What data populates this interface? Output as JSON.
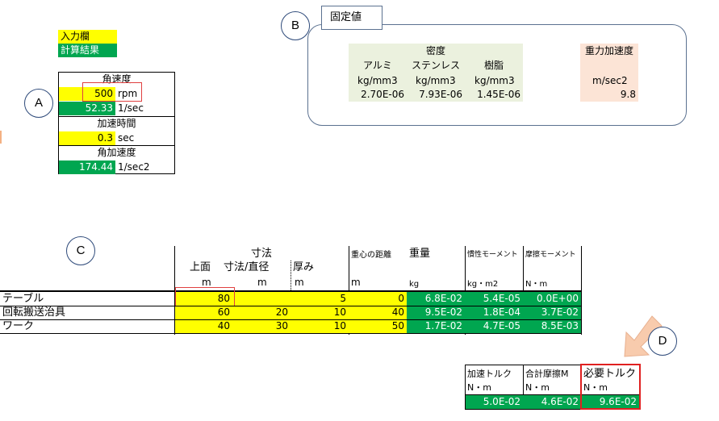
{
  "legend": {
    "input": "入力欄",
    "calc": "計算結果"
  },
  "markers": {
    "a": "A",
    "b": "B",
    "c": "C",
    "d": "D"
  },
  "sectionA": {
    "angvel_label": "角速度",
    "rpm_value": "500",
    "rpm_unit": "rpm",
    "angvel_value": "52.33",
    "angvel_unit": "1/sec",
    "acctime_label": "加速時間",
    "acctime_value": "0.3",
    "acctime_unit": "sec",
    "angacc_label": "角加速度",
    "angacc_value": "174.44",
    "angacc_unit": "1/sec2"
  },
  "sectionB": {
    "title": "固定値",
    "density_label": "密度",
    "materials": [
      "アルミ",
      "ステンレス",
      "樹脂"
    ],
    "units": [
      "kg/mm3",
      "kg/mm3",
      "kg/mm3"
    ],
    "values": [
      "2.70E-06",
      "7.93E-06",
      "1.45E-06"
    ],
    "gravity_label": "重力加速度",
    "gravity_unit": "m/sec2",
    "gravity_value": "9.8"
  },
  "sectionC": {
    "header": {
      "dims": "寸法",
      "top": "上面",
      "dim_dia": "寸法/直径",
      "thick": "厚み",
      "cog": "重心の距離",
      "weight": "重量",
      "inertia": "慣性モーメント",
      "friction": "摩擦モーメント",
      "u_m1": "m",
      "u_m2": "m",
      "u_m3": "m",
      "u_m4": "m",
      "u_kg": "kg",
      "u_kgm2": "kg・m2",
      "u_nm": "N・m"
    },
    "rows": [
      {
        "name": "テーブル",
        "top": "80",
        "dim": "",
        "thick": "5",
        "cog": "0",
        "weight": "6.8E-02",
        "inertia": "5.4E-05",
        "friction": "0.0E+00"
      },
      {
        "name": "回転搬送治具",
        "top": "60",
        "dim": "20",
        "thick": "10",
        "cog": "40",
        "weight": "9.5E-02",
        "inertia": "1.8E-04",
        "friction": "3.7E-02"
      },
      {
        "name": "ワーク",
        "top": "40",
        "dim": "30",
        "thick": "10",
        "cog": "50",
        "weight": "1.7E-02",
        "inertia": "4.7E-05",
        "friction": "8.5E-03"
      }
    ]
  },
  "sectionD": {
    "acc_torque": "加速トルク",
    "total_friction": "合計摩擦M",
    "required_torque": "必要トルク",
    "u1": "N・m",
    "u2": "N・m",
    "u3": "N・m",
    "v1": "5.0E-02",
    "v2": "4.6E-02",
    "v3": "9.6E-02"
  }
}
